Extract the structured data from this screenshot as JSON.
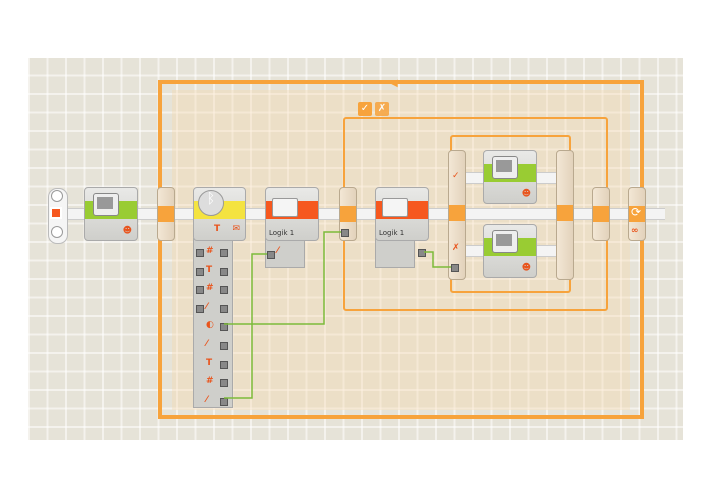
{
  "program": {
    "blocks": [
      {
        "type": "display",
        "icon": "display-icon"
      },
      {
        "type": "bluetooth-receive",
        "icon": "bluetooth-icon"
      },
      {
        "type": "variable",
        "label": "Logik 1",
        "icon": "briefcase-icon"
      },
      {
        "type": "variable",
        "label": "Logik 1",
        "icon": "briefcase-icon"
      }
    ],
    "switch": {
      "true_tab": "✓",
      "false_tab": "✗"
    },
    "loop": {
      "control": "∞"
    },
    "colors": {
      "loop": "#f7a33c",
      "wire": "#7dbb3a",
      "display": "#99cc33",
      "bluetooth": "#f4e340",
      "variable": "#f6581f"
    }
  }
}
